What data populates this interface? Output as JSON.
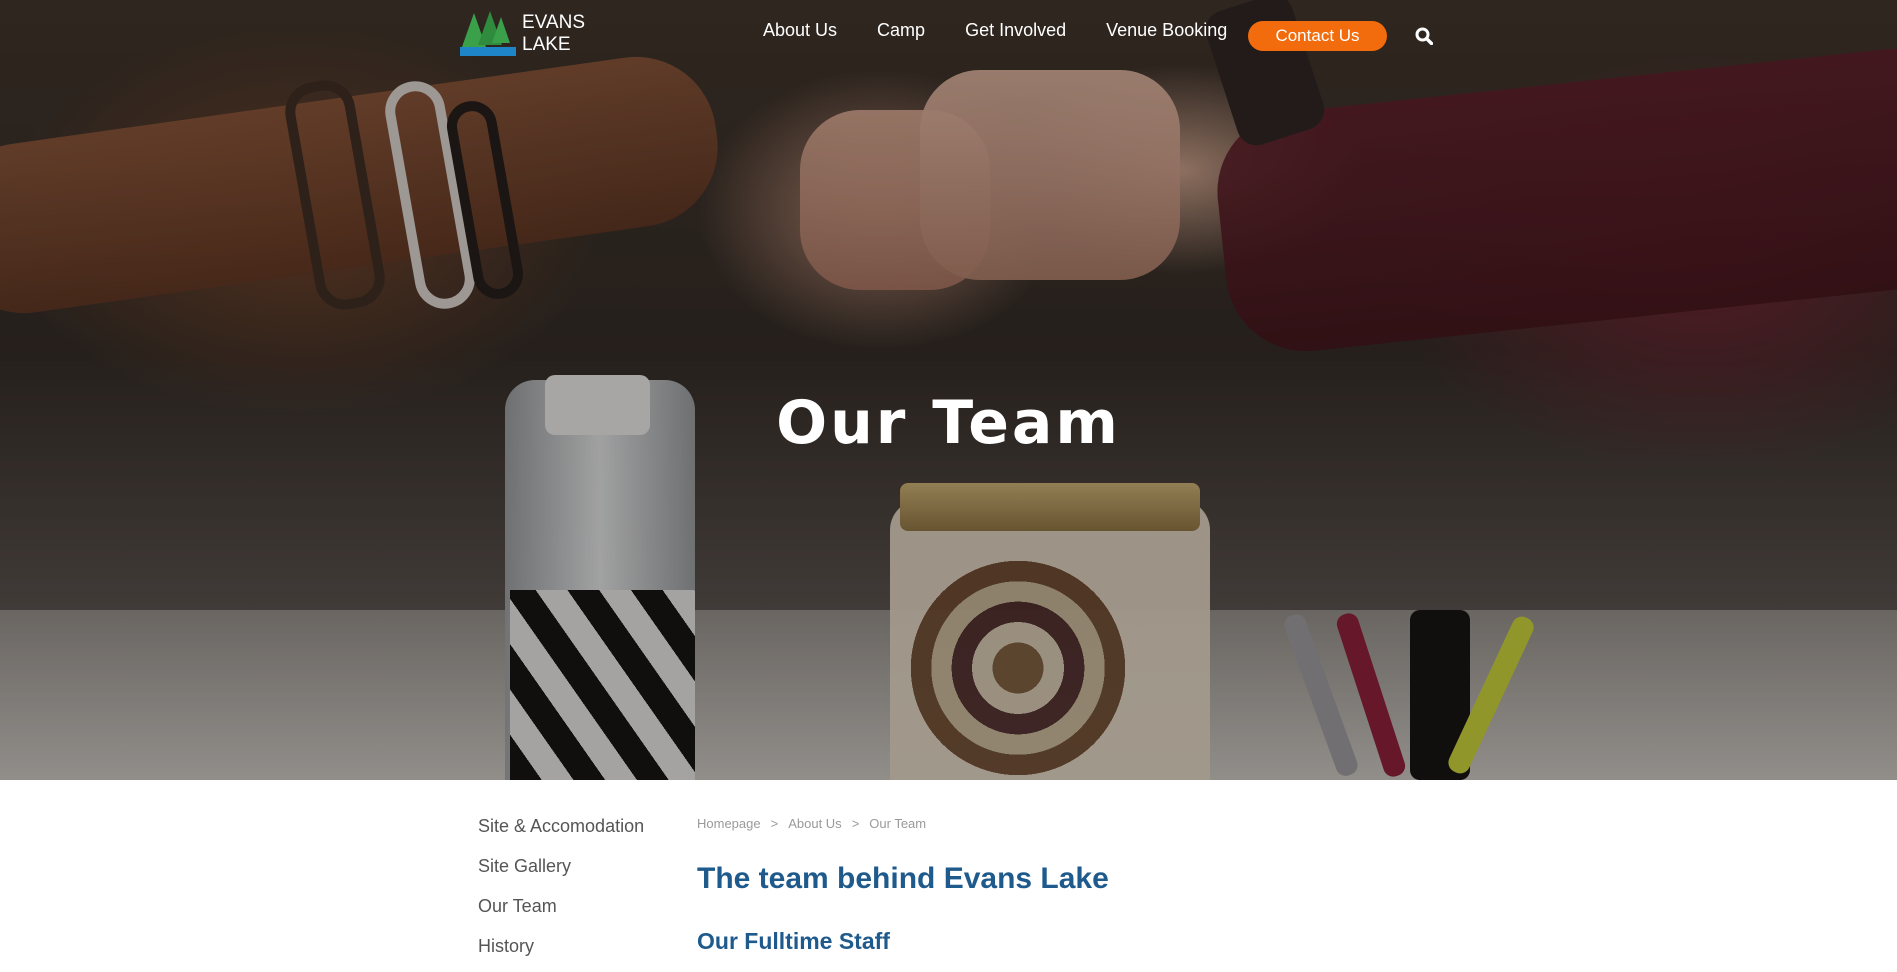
{
  "brand": {
    "line1": "EVANS",
    "line2": "LAKE"
  },
  "nav": {
    "items": [
      "About Us",
      "Camp",
      "Get Involved",
      "Venue Booking"
    ],
    "cta": "Contact Us",
    "search_icon": "search-icon"
  },
  "hero": {
    "title": "Our Team"
  },
  "sidebar": {
    "items": [
      "Site & Accomodation",
      "Site Gallery",
      "Our Team",
      "History"
    ]
  },
  "breadcrumb": {
    "items": [
      "Homepage",
      "About Us",
      "Our Team"
    ],
    "separator": ">"
  },
  "content": {
    "heading": "The team behind Evans Lake",
    "subheading": "Our Fulltime Staff"
  },
  "colors": {
    "accent": "#f26c0e",
    "heading": "#1f5a8c",
    "logo_green": "#3aa14a",
    "logo_blue": "#1e86c8"
  }
}
